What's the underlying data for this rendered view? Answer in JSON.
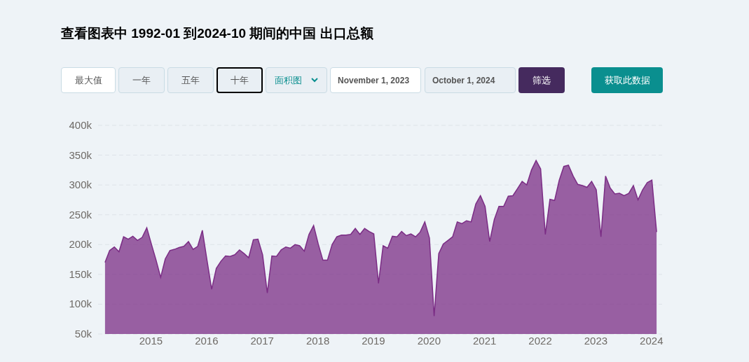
{
  "title": "查看图表中 1992-01 到2024-10 期间的中国 出口总额",
  "range_buttons": [
    {
      "label": "最大值",
      "selected": false,
      "kind": "plain"
    },
    {
      "label": "一年",
      "selected": false,
      "kind": "muted"
    },
    {
      "label": "五年",
      "selected": false,
      "kind": "muted"
    },
    {
      "label": "十年",
      "selected": true,
      "kind": "muted"
    }
  ],
  "chart_type_select": {
    "value": "面积图"
  },
  "date_from": {
    "value": "November 1, 2023",
    "disabled": false
  },
  "date_to": {
    "value": "October 1, 2024",
    "disabled": true
  },
  "filter_button": {
    "label": "筛选"
  },
  "fetch_button": {
    "label": "获取此数据"
  },
  "chart": {
    "chart_data": {
      "type": "area",
      "series": [
        {
          "color": "#7b2d85",
          "values": [
            170,
            190,
            196,
            188,
            213,
            209,
            214,
            207,
            212,
            228,
            201,
            174,
            145,
            176,
            190,
            192,
            195,
            197,
            205,
            192,
            197,
            224,
            174,
            125,
            160,
            172,
            181,
            180,
            183,
            191,
            185,
            178,
            208,
            209,
            183,
            119,
            181,
            180,
            191,
            196,
            194,
            200,
            198,
            189,
            217,
            232,
            201,
            174,
            174,
            200,
            213,
            216,
            216,
            217,
            227,
            217,
            227,
            222,
            218,
            135,
            198,
            194,
            214,
            213,
            222,
            215,
            218,
            213,
            221,
            238,
            211,
            80,
            185,
            201,
            207,
            213,
            238,
            235,
            240,
            238,
            268,
            282,
            264,
            205,
            242,
            264,
            264,
            281,
            282,
            294,
            306,
            300,
            325,
            341,
            327,
            217,
            276,
            274,
            308,
            331,
            333,
            315,
            301,
            299,
            296,
            306,
            292,
            213,
            315,
            295,
            285,
            286,
            282,
            286,
            299,
            275,
            292,
            304,
            308,
            221
          ]
        }
      ],
      "x": [
        2014.25,
        2014.333,
        2014.417,
        2014.5,
        2014.583,
        2014.667,
        2014.75,
        2014.833,
        2014.917,
        2015,
        2015.083,
        2015.167,
        2015.25,
        2015.333,
        2015.417,
        2015.5,
        2015.583,
        2015.667,
        2015.75,
        2015.833,
        2015.917,
        2016,
        2016.083,
        2016.167,
        2016.25,
        2016.333,
        2016.417,
        2016.5,
        2016.583,
        2016.667,
        2016.75,
        2016.833,
        2016.917,
        2017,
        2017.083,
        2017.167,
        2017.25,
        2017.333,
        2017.417,
        2017.5,
        2017.583,
        2017.667,
        2017.75,
        2017.833,
        2017.917,
        2018,
        2018.083,
        2018.167,
        2018.25,
        2018.333,
        2018.417,
        2018.5,
        2018.583,
        2018.667,
        2018.75,
        2018.833,
        2018.917,
        2019,
        2019.083,
        2019.167,
        2019.25,
        2019.333,
        2019.417,
        2019.5,
        2019.583,
        2019.667,
        2019.75,
        2019.833,
        2019.917,
        2020,
        2020.083,
        2020.167,
        2020.25,
        2020.333,
        2020.417,
        2020.5,
        2020.583,
        2020.667,
        2020.75,
        2020.833,
        2020.917,
        2021,
        2021.083,
        2021.167,
        2021.25,
        2021.333,
        2021.417,
        2021.5,
        2021.583,
        2021.667,
        2021.75,
        2021.833,
        2021.917,
        2022,
        2022.083,
        2022.167,
        2022.25,
        2022.333,
        2022.417,
        2022.5,
        2022.583,
        2022.667,
        2022.75,
        2022.833,
        2022.917,
        2023,
        2023.083,
        2023.167,
        2023.25,
        2023.333,
        2023.417,
        2023.5,
        2023.583,
        2023.667,
        2023.75,
        2023.833,
        2023.917,
        2024,
        2024.083,
        2024.167
      ],
      "xlim": [
        2014.125,
        2024.267
      ],
      "grid": true,
      "ylim": [
        50,
        400
      ],
      "xticks": [
        2015,
        2016,
        2017,
        2018,
        2019,
        2020,
        2021,
        2022,
        2023,
        2024
      ],
      "yticks": [
        {
          "value": 50,
          "label": "50k"
        },
        {
          "value": 100,
          "label": "100k"
        },
        {
          "value": 150,
          "label": "150k"
        },
        {
          "value": 200,
          "label": "200k"
        },
        {
          "value": 250,
          "label": "250k"
        },
        {
          "value": 300,
          "label": "300k"
        },
        {
          "value": 350,
          "label": "350k"
        },
        {
          "value": 400,
          "label": "400k"
        }
      ]
    }
  }
}
